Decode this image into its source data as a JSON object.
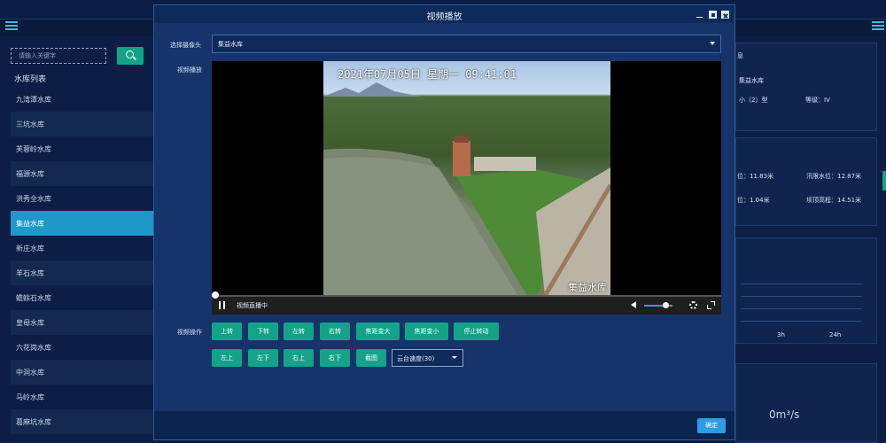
{
  "background": {
    "search": {
      "placeholder": "请输入关键字"
    },
    "list_title": "水库列表",
    "reservoirs": [
      "九湾潭水库",
      "三坑水库",
      "芙蓉岭水库",
      "福源水库",
      "洪秀全水库",
      "集益水库",
      "新庄水库",
      "羊石水库",
      "蟾蜍石水库",
      "皇母水库",
      "六花岗水库",
      "中洞水库",
      "马岭水库",
      "葛麻坑水库"
    ],
    "active_reservoir": "集益水库",
    "info": {
      "title_fragment": "息",
      "name": "集益水库",
      "scale": "小（2）型",
      "grade": "等级：IV",
      "level_partial": "位：11.83米",
      "flood_limit": "汛限水位：12.87米",
      "level2_partial": "位：1.04米",
      "dam_height": "坝顶高程：14.51米",
      "axis_3h": "3h",
      "axis_24h": "24h",
      "flow": "0m³/s"
    }
  },
  "dialog": {
    "title": "视频播放",
    "camera_label": "选择摄像头",
    "camera_value": "集益水库",
    "playback_label": "视频播放",
    "video": {
      "timestamp": "2021年07月05日  星期一  09:41:01",
      "watermark": "集益水库",
      "status": "视频直播中",
      "volume": 0.75
    },
    "ops_label": "视频操作",
    "ops_row1": [
      "上转",
      "下转",
      "左转",
      "右转",
      "焦距变大",
      "焦距变小",
      "停止转动"
    ],
    "ops_row2": [
      "左上",
      "左下",
      "右上",
      "右下",
      "截图"
    ],
    "speed_value": "云台速度(30)",
    "ok": "确定"
  },
  "colors": {
    "accent_green": "#12a389",
    "accent_blue": "#2f9be3",
    "active_item": "#1d98c9"
  },
  "icons": [
    "menu-icon",
    "search-icon",
    "minimize-icon",
    "maximize-icon",
    "close-icon",
    "chevron-down-icon",
    "pause-icon",
    "volume-icon",
    "gear-icon",
    "fullscreen-icon"
  ]
}
